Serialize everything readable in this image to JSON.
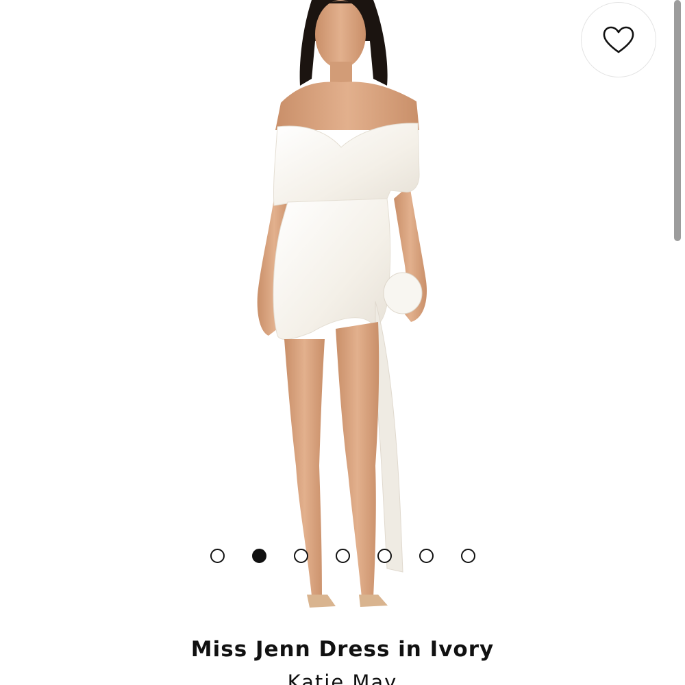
{
  "product": {
    "title": "Miss Jenn Dress in Ivory",
    "brand": "Katie May"
  },
  "wishlist": {
    "icon": "heart-icon"
  },
  "carousel": {
    "total": 7,
    "active_index": 1
  },
  "colors": {
    "text": "#111111",
    "dress": "#f6f3ec",
    "skin": "#d8a27e",
    "hair": "#1b1410"
  }
}
